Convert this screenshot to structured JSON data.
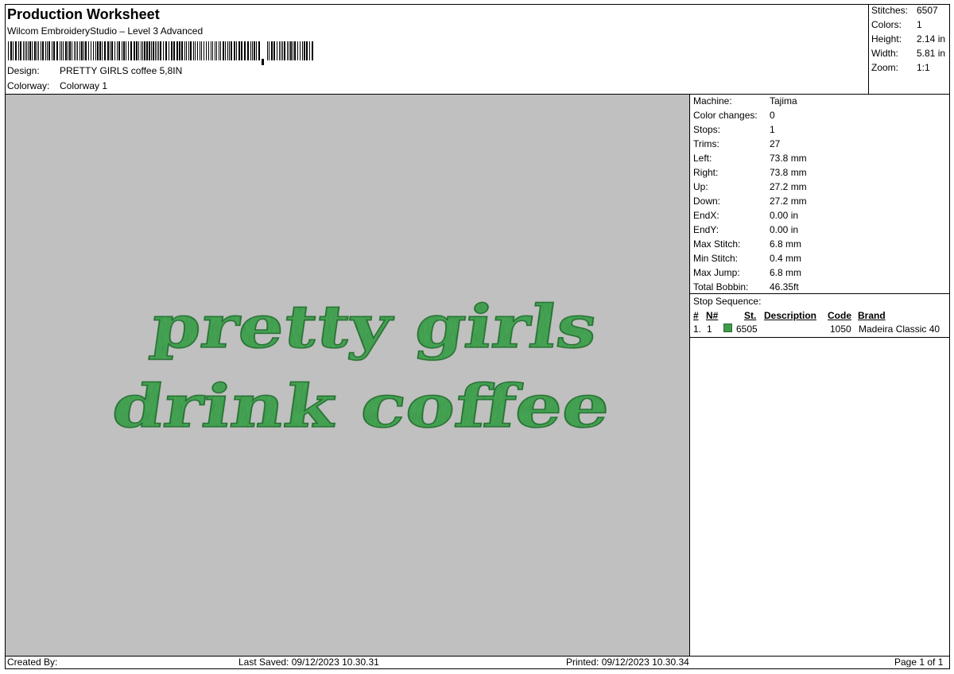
{
  "header": {
    "title": "Production Worksheet",
    "subtitle": "Wilcom EmbroideryStudio – Level 3 Advanced",
    "design_label": "Design:",
    "design_value": "PRETTY GIRLS coffee 5,8IN",
    "colorway_label": "Colorway:",
    "colorway_value": "Colorway 1"
  },
  "summary": [
    {
      "label": "Stitches:",
      "value": "6507"
    },
    {
      "label": "Colors:",
      "value": "1"
    },
    {
      "label": "Height:",
      "value": "2.14 in"
    },
    {
      "label": "Width:",
      "value": "5.81 in"
    },
    {
      "label": "Zoom:",
      "value": "1:1"
    }
  ],
  "stats": [
    {
      "label": "Machine:",
      "value": "Tajima"
    },
    {
      "label": "Color changes:",
      "value": "0"
    },
    {
      "label": "Stops:",
      "value": "1"
    },
    {
      "label": "Trims:",
      "value": "27"
    },
    {
      "label": "Left:",
      "value": "73.8 mm"
    },
    {
      "label": "Right:",
      "value": "73.8 mm"
    },
    {
      "label": "Up:",
      "value": "27.2 mm"
    },
    {
      "label": "Down:",
      "value": "27.2 mm"
    },
    {
      "label": "EndX:",
      "value": "0.00 in"
    },
    {
      "label": "EndY:",
      "value": "0.00 in"
    },
    {
      "label": "Max Stitch:",
      "value": "6.8 mm"
    },
    {
      "label": "Min Stitch:",
      "value": "0.4 mm"
    },
    {
      "label": "Max Jump:",
      "value": "6.8 mm"
    },
    {
      "label": "Total Bobbin:",
      "value": "46.35ft"
    }
  ],
  "stop_sequence": {
    "title": "Stop Sequence:",
    "headers": {
      "num": "#",
      "n": "N#",
      "st": "St.",
      "description": "Description",
      "code": "Code",
      "brand": "Brand"
    },
    "rows": [
      {
        "num": "1.",
        "n": "1",
        "st": "6505",
        "description": "",
        "code": "1050",
        "brand": "Madeira Classic 40",
        "color": "#3f9c4c"
      }
    ]
  },
  "design_preview": {
    "line1": "pretty girls",
    "line2": "drink coffee",
    "thread_color": "#4caf5a",
    "background_color": "#c0c0c0"
  },
  "footer": {
    "created_by": "Created By:",
    "last_saved": "Last Saved: 09/12/2023 10.30.31",
    "printed": "Printed: 09/12/2023 10.30.34",
    "page": "Page 1 of 1"
  }
}
